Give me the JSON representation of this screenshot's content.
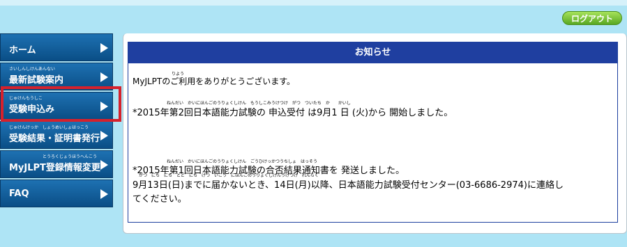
{
  "header": {
    "logout_label": "ログアウト"
  },
  "sidebar": {
    "items": [
      {
        "ruby": "",
        "label": "ホーム"
      },
      {
        "ruby": "さいしんしけんあんない",
        "label": "最新試験案内"
      },
      {
        "ruby": "じゅけんもうしこ",
        "label": "受験申込み"
      },
      {
        "ruby": "じゅけんけっか　しょうめいしょはっこう",
        "label": "受験結果・証明書発行"
      },
      {
        "ruby": "とうろくじょうほうへんこう",
        "label": "MyJLPT登録情報変更"
      },
      {
        "ruby": "",
        "label": "FAQ"
      }
    ]
  },
  "notice": {
    "title": "お知らせ",
    "intro_ruby": "りよう",
    "intro": "MyJLPTのご利用をありがとうございます。",
    "item1_ruby": "ねんだい　かいにほんごのうりょくしけん　もうしこみうけつけ　がつ　ついたち　か　　かいし",
    "item1": "*2015年第2回日本語能力試験の 申込受付 は9月1 日 (火)から 開始しました。",
    "item2_ruby": "ねんだい　かいにほんごのうりょくしけん　ごうひけっかつうちしょ　はっそう",
    "item2": "*2015年第1回日本語能力試験の合否結果通知書を 発送しました。",
    "item3_ruby": "がつ　にち　にち　とど　にち　げつ　いこう　にほんごのうりょくしけんうけつけ　れんらく",
    "item3": "9月13日(日)までに届かないとき、14日(月)以降、日本語能力試験受付センター(03-6686-2974)に連絡し",
    "item3b": "てください。"
  }
}
